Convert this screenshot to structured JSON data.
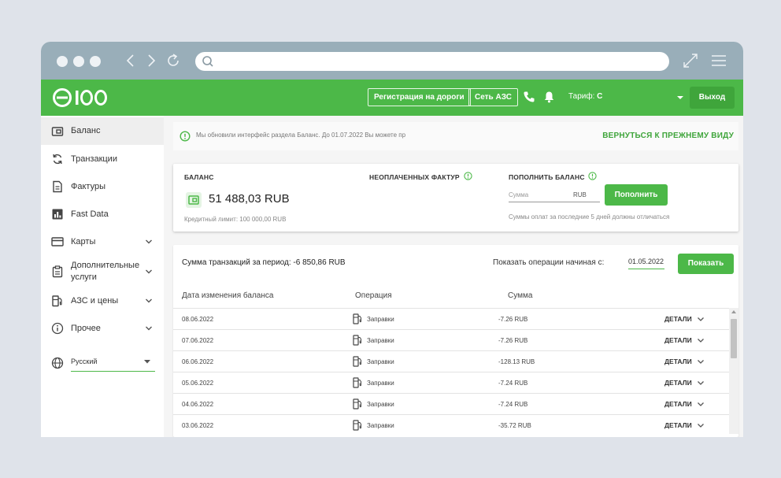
{
  "header": {
    "logo_text": "e100",
    "road_registration": "Регистрация на дороги",
    "station_network": "Сеть АЗС",
    "tariff_label": "Тариф:",
    "tariff_value": "C",
    "logout": "Выход"
  },
  "sidebar": {
    "items": [
      {
        "label": "Баланс",
        "icon": "wallet-icon"
      },
      {
        "label": "Транзакции",
        "icon": "refresh-icon"
      },
      {
        "label": "Фактуры",
        "icon": "document-icon"
      },
      {
        "label": "Fast Data",
        "icon": "chart-icon"
      },
      {
        "label": "Карты",
        "icon": "card-icon"
      },
      {
        "label": "Дополнительные услуги",
        "icon": "clipboard-icon"
      },
      {
        "label": "АЗС и цены",
        "icon": "fuel-pump-icon"
      },
      {
        "label": "Прочее",
        "icon": "info-icon"
      }
    ],
    "language": "Русский"
  },
  "notice": {
    "text": "Мы обновили интерфейс раздела Баланс. До 01.07.2022 Вы можете пр",
    "link": "ВЕРНУТЬСЯ К ПРЕЖНЕМУ ВИДУ"
  },
  "balance": {
    "title": "БАЛАНС",
    "value": "51 488,03 RUB",
    "credit_limit": "Кредитный лимит: 100 000,00 RUB",
    "unpaid_title": "НЕОПЛАЧЕННЫХ ФАКТУР",
    "topup_title": "ПОПОЛНИТЬ БАЛАНС",
    "amount_placeholder": "Сумма",
    "currency": "RUB",
    "topup_button": "Пополнить",
    "topup_note": "Суммы оплат за последние 5 дней должны отличаться"
  },
  "transactions": {
    "period_sum": "Сумма транзакций за период: -6 850,86 RUB",
    "show_from_label": "Показать операции начиная с:",
    "date_from": "01.05.2022",
    "show_button": "Показать",
    "columns": [
      "Дата изменения баланса",
      "Операция",
      "Сумма"
    ],
    "details_label": "ДЕТАЛИ",
    "rows": [
      {
        "date": "08.06.2022",
        "operation": "Заправки",
        "sum": "-7.26 RUB"
      },
      {
        "date": "07.06.2022",
        "operation": "Заправки",
        "sum": "-7.26 RUB"
      },
      {
        "date": "06.06.2022",
        "operation": "Заправки",
        "sum": "-128.13 RUB"
      },
      {
        "date": "05.06.2022",
        "operation": "Заправки",
        "sum": "-7.24 RUB"
      },
      {
        "date": "04.06.2022",
        "operation": "Заправки",
        "sum": "-7.24 RUB"
      },
      {
        "date": "03.06.2022",
        "operation": "Заправки",
        "sum": "-35.72 RUB"
      }
    ]
  },
  "colors": {
    "brand_green": "#4cb848",
    "dark_green": "#3fa53b",
    "chrome": "#99aeb9"
  }
}
